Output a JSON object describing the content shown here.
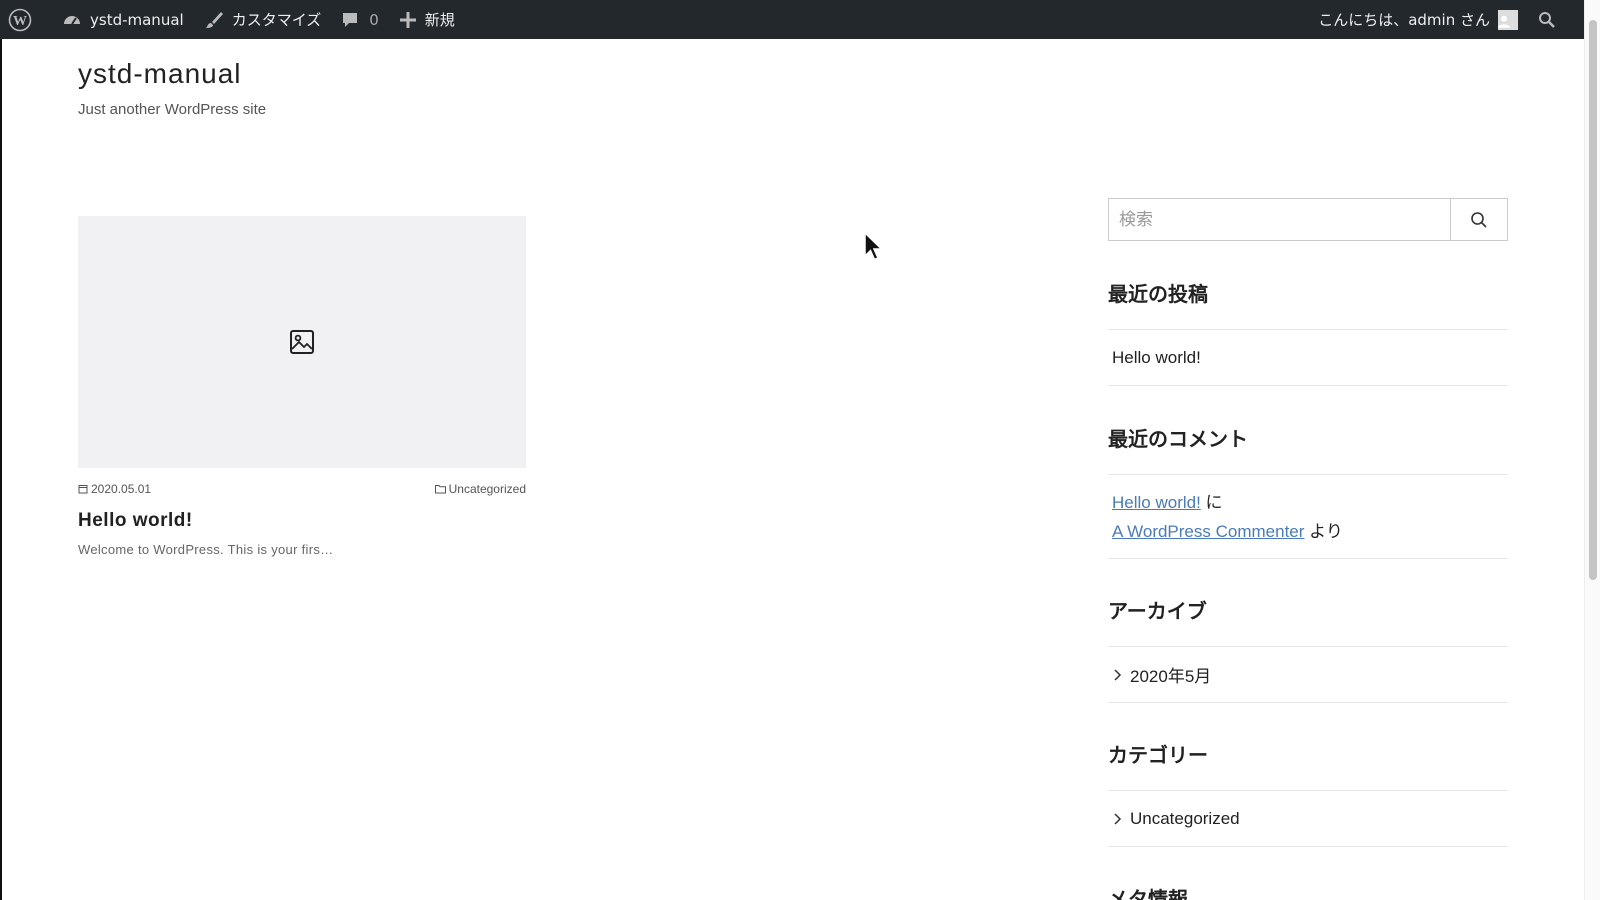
{
  "admin_bar": {
    "site_name": "ystd-manual",
    "customize": "カスタマイズ",
    "comments_count": "0",
    "new_label": "新規",
    "greeting": "こんにちは、admin さん"
  },
  "site": {
    "title": "ystd-manual",
    "description": "Just another WordPress site"
  },
  "post": {
    "date": "2020.05.01",
    "category": "Uncategorized",
    "title": "Hello world!",
    "excerpt": "Welcome to WordPress. This is your firs…"
  },
  "sidebar": {
    "search_placeholder": "検索",
    "recent_posts": {
      "title": "最近の投稿",
      "items": [
        "Hello world!"
      ]
    },
    "recent_comments": {
      "title": "最近のコメント",
      "post_link": "Hello world!",
      "on_text": "に",
      "author_link": "A WordPress Commenter",
      "from_text": "より"
    },
    "archives": {
      "title": "アーカイブ",
      "items": [
        "2020年5月"
      ]
    },
    "categories": {
      "title": "カテゴリー",
      "items": [
        "Uncategorized"
      ]
    },
    "meta": {
      "title": "メタ情報"
    }
  },
  "icons": {
    "wordpress": "wordpress-logo-icon",
    "dashboard": "dashboard-icon",
    "customize": "paintbrush-icon",
    "comments": "comment-bubble-icon",
    "new": "plus-icon",
    "search": "search-icon",
    "image_placeholder": "image-icon",
    "calendar": "calendar-icon",
    "folder": "folder-icon",
    "chevron": "chevron-right-icon"
  },
  "colors": {
    "admin_bar_bg": "#23282d",
    "link": "#4a7bb7",
    "thumb_bg": "#f1f1f3"
  }
}
